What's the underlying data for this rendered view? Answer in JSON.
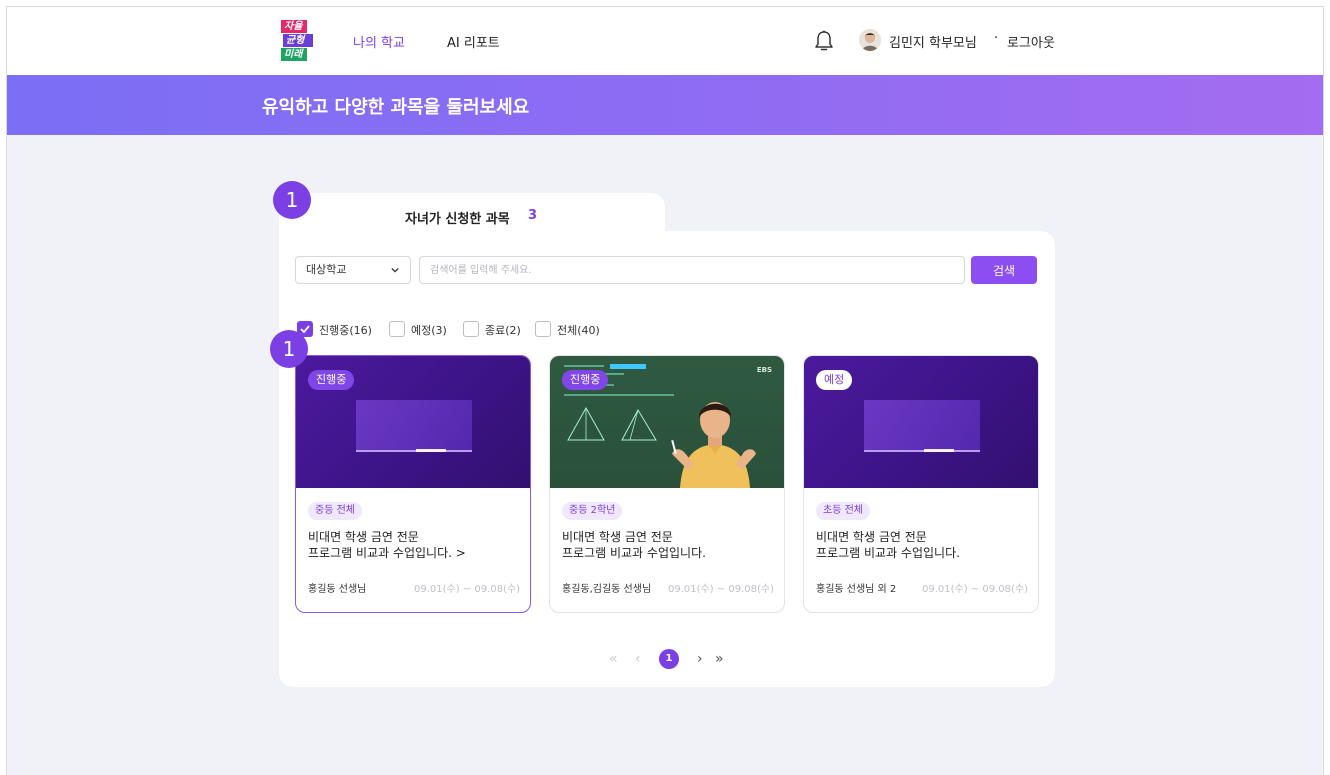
{
  "header": {
    "logo": {
      "line1": "자율",
      "line2": "균형",
      "line3": "미래"
    },
    "nav": [
      {
        "label": "나의 학교",
        "active": true
      },
      {
        "label": "AI 리포트",
        "active": false
      }
    ],
    "user_name": "김민지 학부모님",
    "separator": "·",
    "logout_label": "로그아웃"
  },
  "banner": {
    "title": "유익하고 다양한 과목을 둘러보세요"
  },
  "steps": {
    "tab_badge": "1",
    "card_badge": "1"
  },
  "tab": {
    "label": "자녀가 신청한 과목",
    "count": "3"
  },
  "search": {
    "select_value": "대상학교",
    "placeholder": "검색어를 입력해 주세요.",
    "button_label": "검색"
  },
  "filters": [
    {
      "label": "진행중(16)",
      "checked": true
    },
    {
      "label": "예정(3)",
      "checked": false
    },
    {
      "label": "종료(2)",
      "checked": false
    },
    {
      "label": "전체(40)",
      "checked": false
    }
  ],
  "cards": [
    {
      "status": "진행중",
      "grade": "중등 전체",
      "title_line1": "비대면 학생 금연 전문",
      "title_line2": "프로그램 비교과 수업입니다. >",
      "teacher": "홍길동 선생님",
      "date": "09.01(수) ~ 09.08(수)"
    },
    {
      "status": "진행중",
      "grade": "중등 2학년",
      "title_line1": "비대면 학생 금연 전문",
      "title_line2": "프로그램 비교과 수업입니다.",
      "teacher": "홍길동,김길동 선생님",
      "date": "09.01(수) ~ 09.08(수)",
      "brand": "EBS"
    },
    {
      "status": "예정",
      "grade": "초등 전체",
      "title_line1": "비대면 학생 금연 전문",
      "title_line2": "프로그램 비교과 수업입니다.",
      "teacher": "홍길동 선생님 외 2",
      "date": "09.01(수) ~ 09.08(수)"
    }
  ],
  "pagination": {
    "first": "«",
    "prev": "‹",
    "current": "1",
    "next": "›",
    "last": "»"
  },
  "colors": {
    "accent": "#7b3fe4",
    "banner_start": "#7b6ff5",
    "banner_end": "#a46cf0",
    "background": "#f1f2f7"
  }
}
